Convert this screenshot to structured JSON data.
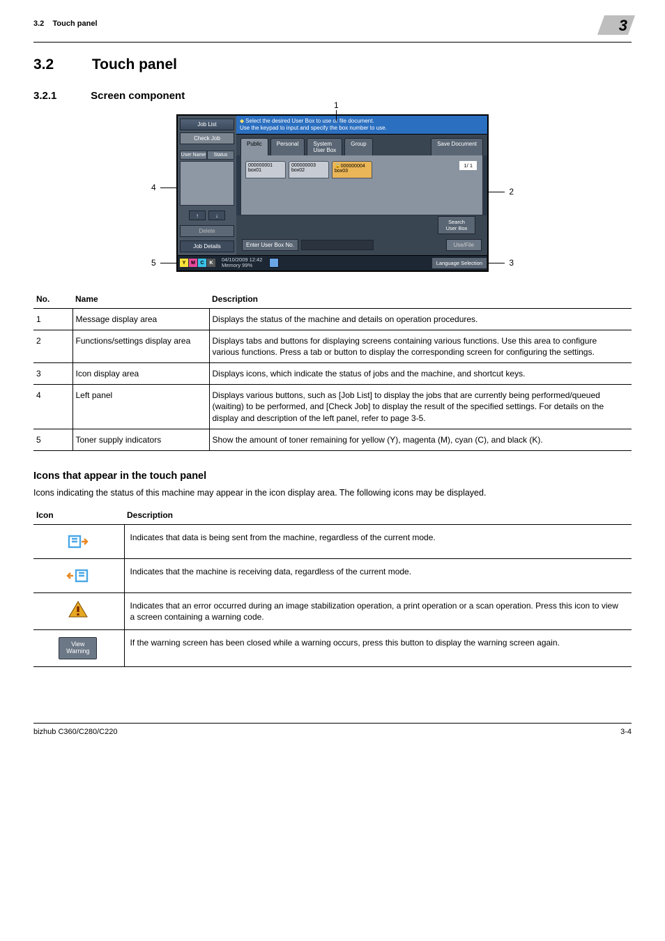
{
  "header": {
    "section_ref": "3.2",
    "section_name": "Touch panel",
    "chapter_num": "3"
  },
  "titles": {
    "h1_no": "3.2",
    "h1_text": "Touch panel",
    "h2_no": "3.2.1",
    "h2_text": "Screen component",
    "h3_text": "Icons that appear in the touch panel"
  },
  "callouts": {
    "c1": "1",
    "c2": "2",
    "c3": "3",
    "c4": "4",
    "c5": "5"
  },
  "screen": {
    "left_panel": {
      "job_list": "Job List",
      "check_job": "Check Job",
      "col_user": "User\nName",
      "col_status": "Status",
      "arrow_up": "↑",
      "arrow_down": "↓",
      "delete": "Delete",
      "job_details": "Job Details"
    },
    "msg_line1": "Select the desired User Box to use or file document.",
    "msg_line2": "Use the keypad to input and specify the box number to use.",
    "tabs": {
      "public": "Public",
      "personal": "Personal",
      "system": "System\nUser Box",
      "group": "Group",
      "save": "Save Document"
    },
    "boxes": {
      "b1_no": "000000001",
      "b1_name": "box01",
      "b2_no": "000000003",
      "b2_name": "box02",
      "b3_no": "000000004",
      "b3_name": "box03",
      "page": "1/ 1"
    },
    "search": "Search\nUser Box",
    "enter_label": "Enter User Box No.",
    "use_file": "Use/File",
    "toners": {
      "y": "Y",
      "m": "M",
      "c": "C",
      "k": "K"
    },
    "datetime": "04/10/2009   12:42",
    "memory": "Memory        99%",
    "language": "Language Selection"
  },
  "table1": {
    "head_no": "No.",
    "head_name": "Name",
    "head_desc": "Description",
    "rows": [
      {
        "no": "1",
        "name": "Message display area",
        "desc": "Displays the status of the machine and details on operation procedures."
      },
      {
        "no": "2",
        "name": "Functions/settings display area",
        "desc": "Displays tabs and buttons for displaying screens containing various functions. Use this area to configure various functions. Press a tab or button to display the corresponding screen for configuring the settings."
      },
      {
        "no": "3",
        "name": "Icon display area",
        "desc": "Displays icons, which indicate the status of jobs and the machine, and shortcut keys."
      },
      {
        "no": "4",
        "name": "Left panel",
        "desc": "Displays various buttons, such as [Job List] to display the jobs that are currently being performed/queued (waiting) to be performed, and [Check Job] to display the result of the specified settings. For details on the display and description of the left panel, refer to page 3-5."
      },
      {
        "no": "5",
        "name": "Toner supply indicators",
        "desc": "Show the amount of toner remaining for yellow (Y), magenta (M), cyan (C), and black (K)."
      }
    ]
  },
  "icons_intro": "Icons indicating the status of this machine may appear in the icon display area. The following icons may be displayed.",
  "table2": {
    "head_icon": "Icon",
    "head_desc": "Description",
    "rows": [
      {
        "desc": "Indicates that data is being sent from the machine, regardless of the current mode."
      },
      {
        "desc": "Indicates that the machine is receiving data, regardless of the current mode."
      },
      {
        "desc": "Indicates that an error occurred during an image stabilization operation, a print operation or a scan operation. Press this icon to view a screen containing a warning code."
      },
      {
        "desc": "If the warning screen has been closed while a warning occurs, press this button to display the warning screen again."
      }
    ],
    "view_warning": "View\nWarning"
  },
  "footer": {
    "left": "bizhub C360/C280/C220",
    "right": "3-4"
  }
}
